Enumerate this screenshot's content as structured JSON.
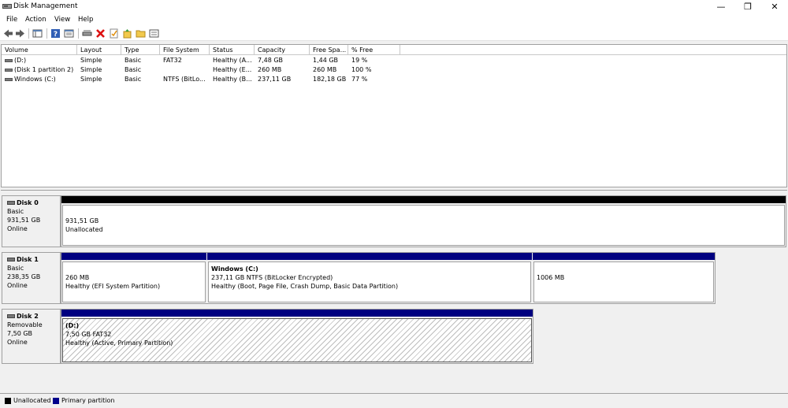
{
  "window": {
    "title": "Disk Management",
    "minimize": "—",
    "restore": "❐",
    "close": "✕"
  },
  "menu": [
    "File",
    "Action",
    "View",
    "Help"
  ],
  "toolbar": [
    "back-icon",
    "forward-icon",
    "console-tree-icon",
    "help-icon",
    "properties-icon",
    "connect-icon",
    "delete-icon",
    "check-icon",
    "folder-up-icon",
    "folder-icon",
    "list-icon"
  ],
  "columns": [
    "Volume",
    "Layout",
    "Type",
    "File System",
    "Status",
    "Capacity",
    "Free Spa...",
    "% Free"
  ],
  "volumes": [
    [
      "(D:)",
      "Simple",
      "Basic",
      "FAT32",
      "Healthy (A...",
      "7,48 GB",
      "1,44 GB",
      "19 %"
    ],
    [
      "(Disk 1 partition 2)",
      "Simple",
      "Basic",
      "",
      "Healthy (E...",
      "260 MB",
      "260 MB",
      "100 %"
    ],
    [
      "Windows (C:)",
      "Simple",
      "Basic",
      "NTFS (BitLo...",
      "Healthy (B...",
      "237,11 GB",
      "182,18 GB",
      "77 %"
    ]
  ],
  "disks": [
    {
      "name": "Disk 0",
      "type": "Basic",
      "size": "931,51 GB",
      "state": "Online",
      "partitions": [
        {
          "title": "",
          "line1": "931,51 GB",
          "line2": "Unallocated"
        }
      ]
    },
    {
      "name": "Disk 1",
      "type": "Basic",
      "size": "238,35 GB",
      "state": "Online",
      "partitions": [
        {
          "title": "",
          "line1": "260 MB",
          "line2": "Healthy (EFI System Partition)"
        },
        {
          "title": "Windows  (C:)",
          "line1": "237,11 GB NTFS (BitLocker Encrypted)",
          "line2": "Healthy (Boot, Page File, Crash Dump, Basic Data Partition)"
        },
        {
          "title": "",
          "line1": "1006 MB",
          "line2": ""
        }
      ]
    },
    {
      "name": "Disk 2",
      "type": "Removable",
      "size": "7,50 GB",
      "state": "Online",
      "partitions": [
        {
          "title": "(D:)",
          "line1": "7,50 GB FAT32",
          "line2": "Healthy (Active, Primary Partition)"
        }
      ]
    }
  ],
  "legend": [
    {
      "label": "Unallocated",
      "color": "#000000"
    },
    {
      "label": "Primary partition",
      "color": "#00008b"
    }
  ],
  "colors": {
    "unallocated": "#000000",
    "primary": "#000080"
  }
}
